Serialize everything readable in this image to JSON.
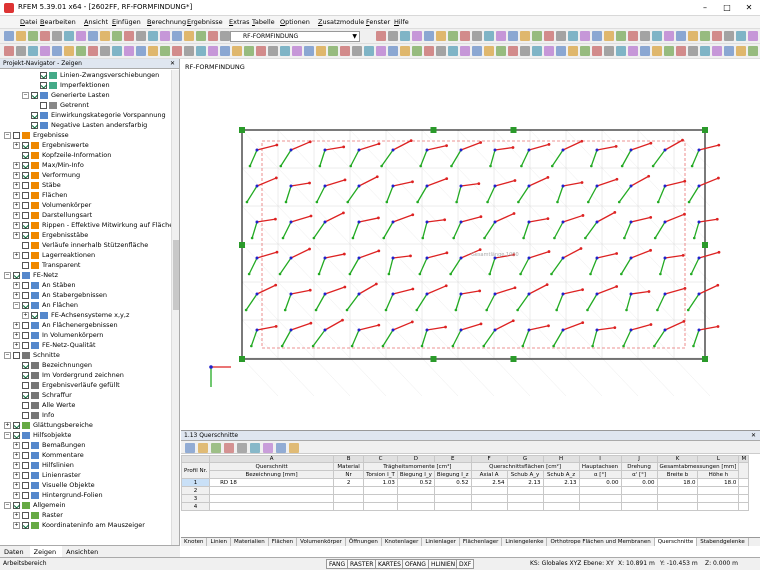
{
  "window": {
    "title": "RFEM 5.39.01 x64 - [2602FF, RF-FORMFINDUNG*]",
    "min": "–",
    "max": "□",
    "close": "✕"
  },
  "menu": [
    "Datei",
    "Bearbeiten",
    "Ansicht",
    "Einfügen",
    "Berechnung",
    "Ergebnisse",
    "Extras",
    "Tabelle",
    "Optionen",
    "Zusatzmodule",
    "Fenster",
    "Hilfe"
  ],
  "toolbar": {
    "case_combo": "RF-FORMFINDUNG"
  },
  "navigator": {
    "title": "Projekt-Navigator - Zeigen",
    "close": "✕",
    "items": [
      {
        "label": "Linien-Zwangsverschiebungen",
        "level": 4,
        "exp": "",
        "chk": true,
        "icon": "#4a8"
      },
      {
        "label": "Imperfektionen",
        "level": 4,
        "exp": "",
        "chk": true,
        "icon": "#4a8"
      },
      {
        "label": "Generierte Lasten",
        "level": 3,
        "exp": "−",
        "chk": true,
        "icon": "#58c"
      },
      {
        "label": "Getrennt",
        "level": 4,
        "exp": "",
        "chk": false,
        "icon": "#888"
      },
      {
        "label": "Einwirkungskategorie Vorspannung",
        "level": 3,
        "exp": "",
        "chk": true,
        "icon": "#58c"
      },
      {
        "label": "Negative Lasten andersfarbig",
        "level": 3,
        "exp": "",
        "chk": true,
        "icon": "#58c"
      },
      {
        "label": "Ergebnisse",
        "level": 1,
        "exp": "−",
        "chk": false,
        "icon": "#e80"
      },
      {
        "label": "Ergebniswerte",
        "level": 2,
        "exp": "+",
        "chk": true,
        "icon": "#e80"
      },
      {
        "label": "Kopfzeile-Information",
        "level": 2,
        "exp": "",
        "chk": true,
        "icon": "#e80"
      },
      {
        "label": "Max/Min-Info",
        "level": 2,
        "exp": "+",
        "chk": true,
        "icon": "#e80"
      },
      {
        "label": "Verformung",
        "level": 2,
        "exp": "+",
        "chk": true,
        "icon": "#e80"
      },
      {
        "label": "Stäbe",
        "level": 2,
        "exp": "+",
        "chk": false,
        "icon": "#e80"
      },
      {
        "label": "Flächen",
        "level": 2,
        "exp": "+",
        "chk": false,
        "icon": "#e80"
      },
      {
        "label": "Volumenkörper",
        "level": 2,
        "exp": "+",
        "chk": false,
        "icon": "#e80"
      },
      {
        "label": "Darstellungsart",
        "level": 2,
        "exp": "+",
        "chk": false,
        "icon": "#e80"
      },
      {
        "label": "Rippen - Effektive Mitwirkung auf Fläche/",
        "level": 2,
        "exp": "+",
        "chk": true,
        "icon": "#e80"
      },
      {
        "label": "Ergebnisstäbe",
        "level": 2,
        "exp": "+",
        "chk": true,
        "icon": "#e80"
      },
      {
        "label": "Verläufe innerhalb Stützenfläche",
        "level": 2,
        "exp": "",
        "chk": false,
        "icon": "#e80"
      },
      {
        "label": "Lagerreaktionen",
        "level": 2,
        "exp": "+",
        "chk": false,
        "icon": "#e80"
      },
      {
        "label": "Transparent",
        "level": 2,
        "exp": "",
        "chk": false,
        "icon": "#e80"
      },
      {
        "label": "FE-Netz",
        "level": 1,
        "exp": "−",
        "chk": true,
        "icon": "#58c"
      },
      {
        "label": "An Stäben",
        "level": 2,
        "exp": "+",
        "chk": false,
        "icon": "#58c"
      },
      {
        "label": "An Stabergebnissen",
        "level": 2,
        "exp": "+",
        "chk": false,
        "icon": "#58c"
      },
      {
        "label": "An Flächen",
        "level": 2,
        "exp": "−",
        "chk": true,
        "icon": "#58c"
      },
      {
        "label": "FE-Achsensysteme x,y,z",
        "level": 3,
        "exp": "+",
        "chk": true,
        "icon": "#58c"
      },
      {
        "label": "An Flächenergebnissen",
        "level": 2,
        "exp": "+",
        "chk": false,
        "icon": "#58c"
      },
      {
        "label": "In Volumenkörpern",
        "level": 2,
        "exp": "+",
        "chk": false,
        "icon": "#58c"
      },
      {
        "label": "FE-Netz-Qualität",
        "level": 2,
        "exp": "+",
        "chk": false,
        "icon": "#58c"
      },
      {
        "label": "Schnitte",
        "level": 1,
        "exp": "−",
        "chk": false,
        "icon": "#777"
      },
      {
        "label": "Bezeichnungen",
        "level": 2,
        "exp": "",
        "chk": true,
        "icon": "#777"
      },
      {
        "label": "Im Vordergrund zeichnen",
        "level": 2,
        "exp": "",
        "chk": true,
        "icon": "#777"
      },
      {
        "label": "Ergebnisverläufe gefüllt",
        "level": 2,
        "exp": "",
        "chk": false,
        "icon": "#777"
      },
      {
        "label": "Schraffur",
        "level": 2,
        "exp": "",
        "chk": true,
        "icon": "#777"
      },
      {
        "label": "Alle Werte",
        "level": 2,
        "exp": "",
        "chk": false,
        "icon": "#777"
      },
      {
        "label": "Info",
        "level": 2,
        "exp": "",
        "chk": false,
        "icon": "#777"
      },
      {
        "label": "Glättungsbereiche",
        "level": 1,
        "exp": "+",
        "chk": true,
        "icon": "#6a4"
      },
      {
        "label": "Hilfsobjekte",
        "level": 1,
        "exp": "−",
        "chk": true,
        "icon": "#58c"
      },
      {
        "label": "Bemaßungen",
        "level": 2,
        "exp": "+",
        "chk": false,
        "icon": "#58c"
      },
      {
        "label": "Kommentare",
        "level": 2,
        "exp": "+",
        "chk": false,
        "icon": "#58c"
      },
      {
        "label": "Hilfslinien",
        "level": 2,
        "exp": "+",
        "chk": false,
        "icon": "#58c"
      },
      {
        "label": "Linienraster",
        "level": 2,
        "exp": "+",
        "chk": false,
        "icon": "#58c"
      },
      {
        "label": "Visuelle Objekte",
        "level": 2,
        "exp": "+",
        "chk": false,
        "icon": "#58c"
      },
      {
        "label": "Hintergrund-Folien",
        "level": 2,
        "exp": "+",
        "chk": false,
        "icon": "#58c"
      },
      {
        "label": "Allgemein",
        "level": 1,
        "exp": "−",
        "chk": true,
        "icon": "#6a4"
      },
      {
        "label": "Raster",
        "level": 2,
        "exp": "+",
        "chk": false,
        "icon": "#6a4"
      },
      {
        "label": "Koordinateninfo am Mauszeiger",
        "level": 2,
        "exp": "+",
        "chk": true,
        "icon": "#6a4"
      }
    ],
    "tabs": [
      "Daten",
      "Zeigen",
      "Ansichten"
    ]
  },
  "viewport": {
    "label": "RF-FORMFINDUNG",
    "center_label": "Gesamtlänge 1000"
  },
  "grid": {
    "title": "1.13 Querschnitte",
    "close": "✕",
    "col_letters": [
      "A",
      "B",
      "C",
      "D",
      "E",
      "F",
      "G",
      "H",
      "I",
      "J",
      "K",
      "L",
      "M"
    ],
    "row_header": "Profil Nr.",
    "group_headers": [
      "Querschnitt",
      "Material",
      "Trägheitsmomente [cm⁴]",
      "Querschnittsflächen [cm²]",
      "Hauptachsen",
      "Drehung",
      "Gesamtabmessungen [mm]"
    ],
    "sub_headers": [
      "Bezeichnung [mm]",
      "Nr",
      "Torsion I_T",
      "Biegung I_y",
      "Biegung I_z",
      "Axial A",
      "Schub A_y",
      "Schub A_z",
      "α [°]",
      "α' [°]",
      "Breite b",
      "Höhe h"
    ],
    "rows": [
      {
        "nr": "1",
        "name": "RD 18",
        "mat": "2",
        "it": "1.03",
        "iy": "0.52",
        "iz": "0.52",
        "a": "2.54",
        "ay": "2.13",
        "az": "2.13",
        "alpha": "0.00",
        "alpha2": "0.00",
        "b": "18.0",
        "h": "18.0"
      },
      {
        "nr": "2",
        "name": "",
        "mat": "",
        "it": "",
        "iy": "",
        "iz": "",
        "a": "",
        "ay": "",
        "az": "",
        "alpha": "",
        "alpha2": "",
        "b": "",
        "h": ""
      },
      {
        "nr": "3",
        "name": "",
        "mat": "",
        "it": "",
        "iy": "",
        "iz": "",
        "a": "",
        "ay": "",
        "az": "",
        "alpha": "",
        "alpha2": "",
        "b": "",
        "h": ""
      },
      {
        "nr": "4",
        "name": "",
        "mat": "",
        "it": "",
        "iy": "",
        "iz": "",
        "a": "",
        "ay": "",
        "az": "",
        "alpha": "",
        "alpha2": "",
        "b": "",
        "h": ""
      }
    ],
    "sheets": [
      "Knoten",
      "Linien",
      "Materialien",
      "Flächen",
      "Volumenkörper",
      "Öffnungen",
      "Knotenlager",
      "Linienlager",
      "Flächenlager",
      "Liniengelenke",
      "Orthotrope Flächen und Membranen",
      "Querschnitte",
      "Stabendgelenke"
    ],
    "active_sheet": "Querschnitte"
  },
  "status": {
    "left": "Arbeitsbereich",
    "toggles": [
      "FANG",
      "RASTER",
      "KARTES",
      "OFANG",
      "HLINIEN",
      "DXF"
    ],
    "coords": "KS: Globales XYZ Ebene: XY",
    "x": "X: 10.891 m",
    "y": "Y: -10.453 m",
    "z": "Z: 0.000 m"
  }
}
